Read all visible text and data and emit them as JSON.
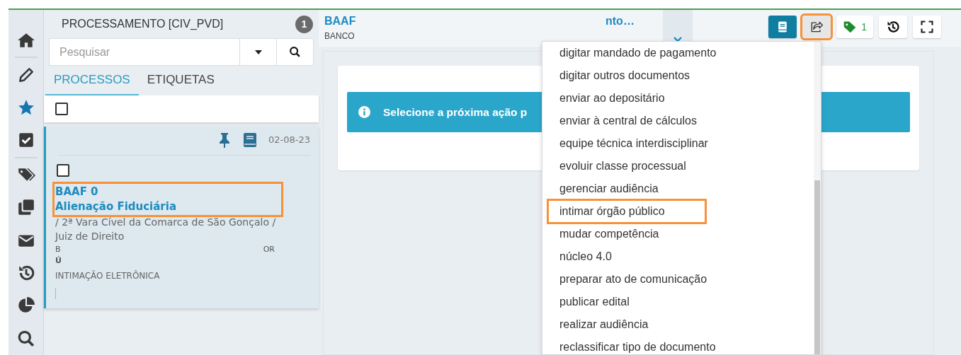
{
  "rail": {
    "items": [
      {
        "selected": false
      },
      {
        "selected": false
      },
      {
        "selected": true
      },
      {
        "selected": false
      },
      {
        "selected": false
      },
      {
        "selected": false
      },
      {
        "selected": false
      },
      {
        "selected": false
      },
      {
        "selected": false
      },
      {
        "selected": false
      }
    ]
  },
  "list_panel": {
    "title": "PROCESSAMENTO [CIV_PVD]",
    "count": "1",
    "search": {
      "placeholder": "Pesquisar"
    },
    "tabs": [
      {
        "label": "PROCESSOS",
        "selected": true
      },
      {
        "label": "ETIQUETAS",
        "selected": false
      }
    ],
    "select_all": {
      "checked": false
    },
    "cards": [
      {
        "date": "02-08-23",
        "checked": false,
        "title": "BAAF 0",
        "subtitle": "Alienação Fiduciária",
        "highlighted": true,
        "court": "/ 2ª Vara Cível da Comarca de São Gonçalo /",
        "judge": "Juiz de Direito",
        "fragments": [
          {
            "left": "B",
            "right": "OR"
          },
          {
            "left": "Ú"
          }
        ],
        "type": "INTIMAÇÃO ELETRÔNICA"
      }
    ]
  },
  "header": {
    "title": "BAAF",
    "subtitle": "BANCO",
    "title_tail": "nto…",
    "buttons": [
      {
        "kind": "primary",
        "highlighted": false
      },
      {
        "kind": "active",
        "highlighted": true
      },
      {
        "kind": "count",
        "count": "1",
        "highlighted": false
      },
      {
        "kind": "plain",
        "highlighted": false
      },
      {
        "kind": "plain",
        "highlighted": false
      }
    ]
  },
  "alert": {
    "text": "Selecione a próxima ação p"
  },
  "action_menu": {
    "items": [
      {
        "label": "digitar mandado de pagamento",
        "highlighted": false
      },
      {
        "label": "digitar outros documentos",
        "highlighted": false
      },
      {
        "label": "enviar ao depositário",
        "highlighted": false
      },
      {
        "label": "enviar à central de cálculos",
        "highlighted": false
      },
      {
        "label": "equipe técnica interdisciplinar",
        "highlighted": false
      },
      {
        "label": "evoluir classe processual",
        "highlighted": false
      },
      {
        "label": "gerenciar audiência",
        "highlighted": false
      },
      {
        "label": "intimar órgão público",
        "highlighted": true
      },
      {
        "label": "mudar competência",
        "highlighted": false
      },
      {
        "label": "núcleo 4.0",
        "highlighted": false
      },
      {
        "label": "preparar ato de comunicação",
        "highlighted": false
      },
      {
        "label": "publicar edital",
        "highlighted": false
      },
      {
        "label": "realizar audiência",
        "highlighted": false
      },
      {
        "label": "reclassificar tipo de documento",
        "highlighted": false
      }
    ]
  }
}
